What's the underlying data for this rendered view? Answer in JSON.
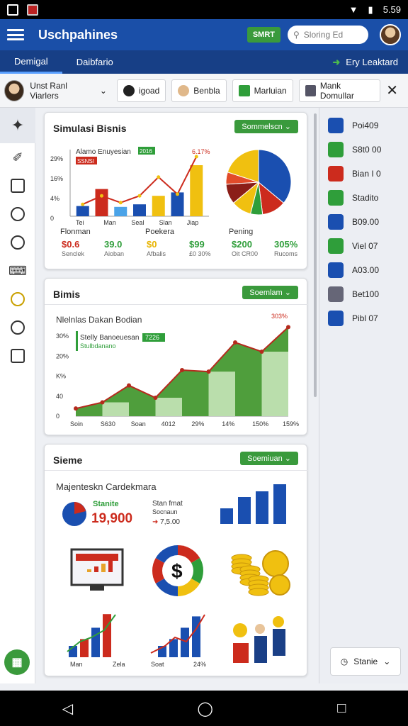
{
  "status_bar": {
    "time": "5.59"
  },
  "app": {
    "title": "Uschpahines",
    "smart_label": "SMRT",
    "search_placeholder": "Sloring Ed"
  },
  "tabs": [
    {
      "label": "Demigal"
    },
    {
      "label": "Daibfario"
    }
  ],
  "tab_right": {
    "label": "Ery Leaktard"
  },
  "chips": {
    "first": "Unst Ranl Viarlers",
    "items": [
      {
        "label": "igoad"
      },
      {
        "label": "Benbla"
      },
      {
        "label": "Marluian"
      },
      {
        "label": "Mank Domullar"
      }
    ]
  },
  "card1": {
    "title": "Simulasi Bisnis",
    "button": "Sommelscn",
    "chart_data": {
      "type": "bar",
      "title": "Alamo Enuyesian",
      "legend": [
        "2016",
        "SSNSI"
      ],
      "xticks": [
        "Tei",
        "Man",
        "Seal",
        "Slan",
        "Jiap"
      ],
      "yticks": [
        "29%",
        "16%",
        "4%",
        "0"
      ],
      "annotation": "6.17%",
      "bars": [
        {
          "color": "#1a4fb0",
          "value": 12
        },
        {
          "color": "#cc2b1d",
          "value": 32
        },
        {
          "color": "#4aa3e8",
          "value": 11
        },
        {
          "color": "#1a4fb0",
          "value": 14
        },
        {
          "color": "#f0c010",
          "value": 24
        },
        {
          "color": "#1a4fb0",
          "value": 28
        },
        {
          "color": "#f0c010",
          "value": 60
        }
      ],
      "line": [
        14,
        24,
        16,
        24,
        46,
        26,
        70
      ],
      "pie": [
        {
          "color": "#1a4fb0",
          "value": 36
        },
        {
          "color": "#cc2b1d",
          "value": 12
        },
        {
          "color": "#2f9e3a",
          "value": 6
        },
        {
          "color": "#f0c010",
          "value": 10
        },
        {
          "color": "#8b1e18",
          "value": 10
        },
        {
          "color": "#e24b2a",
          "value": 6
        },
        {
          "color": "#f0c010",
          "value": 20
        }
      ]
    },
    "labels": {
      "l1": "Flonman",
      "l2": "Poekera",
      "l3": "Pening"
    },
    "stats": [
      {
        "value": "$0.6",
        "sub": "Senclek",
        "color": "#cc2b1d"
      },
      {
        "value": "39.0",
        "sub": "Aioban",
        "color": "#2f9e3a"
      },
      {
        "value": "$0",
        "sub": "Afbalis",
        "color": "#e8b400"
      },
      {
        "value": "$99",
        "sub": "£0 30%",
        "color": "#2f9e3a"
      },
      {
        "value": "$200",
        "sub": "Oit CR00",
        "color": "#2f9e3a"
      },
      {
        "value": "305%",
        "sub": "Rucoms",
        "color": "#2f9e3a"
      }
    ]
  },
  "card2": {
    "title": "Bimis",
    "button": "Soemlam",
    "chart_data": {
      "type": "area",
      "title": "Nlelnlas Dakan Bodian",
      "legend": [
        "Stelly Banoeuesan",
        "7226",
        "Stulbdanano"
      ],
      "annotation": "303%",
      "xticks": [
        "Soin",
        "S630",
        "Soan",
        "4012",
        "29%",
        "14%",
        "150%",
        "159%"
      ],
      "yticks": [
        "30%",
        "20%",
        "K%",
        "40",
        "0"
      ],
      "y": [
        5,
        9,
        20,
        12,
        30,
        29,
        48,
        42,
        58
      ]
    }
  },
  "card3": {
    "title": "Sieme",
    "button": "Soemiuan",
    "subtitle": "Majenteskn Cardekmara",
    "stat_title": "Stanite",
    "stat_value": "19,900",
    "stat2_title": "Stan fmat",
    "stat2_sub": "Socnaun",
    "stat2_value": "7,5.00",
    "bars_right": [
      22,
      38,
      46,
      56
    ],
    "mini1": {
      "labels": [
        "Man",
        "Zela"
      ],
      "bars": [
        10,
        16,
        26,
        38
      ]
    },
    "mini2": {
      "labels": [
        "Soat",
        "24%"
      ],
      "bars": [
        10,
        16,
        26,
        36
      ]
    }
  },
  "right_items": [
    {
      "label": "Poi409",
      "color": "#1a4fb0"
    },
    {
      "label": "S8t0 00",
      "color": "#2f9e3a"
    },
    {
      "label": "Bian I 0",
      "color": "#cc2b1d"
    },
    {
      "label": "Stadito",
      "color": "#2f9e3a"
    },
    {
      "label": "B09.00",
      "color": "#1a4fb0"
    },
    {
      "label": "Viel 07",
      "color": "#2f9e3a"
    },
    {
      "label": "A03.00",
      "color": "#1a4fb0"
    },
    {
      "label": "Bet100",
      "color": "#667"
    },
    {
      "label": "Pibl 07",
      "color": "#1a4fb0"
    }
  ],
  "statie_label": "Stanie"
}
